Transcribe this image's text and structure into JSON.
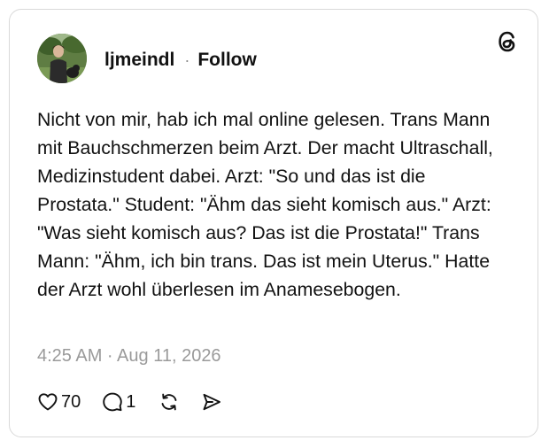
{
  "post": {
    "username": "ljmeindl",
    "separator": "·",
    "follow_label": "Follow",
    "text": "Nicht von mir, hab ich mal online gelesen. Trans Mann mit Bauchschmerzen beim Arzt. Der macht Ultraschall, Medizinstudent dabei. Arzt: \"So und das ist die Prostata.\" Student: \"Ähm das sieht komisch aus.\" Arzt: \"Was sieht komisch aus? Das ist die Prostata!\" Trans Mann: \"Ähm, ich bin trans. Das ist mein Uterus.\" Hatte der Arzt wohl überlesen im Anamesebogen.",
    "timestamp": "4:25 AM · Aug 11, 2026"
  },
  "actions": {
    "like_count": "70",
    "reply_count": "1"
  },
  "icons": {
    "logo": "threads-logo-icon",
    "like": "heart-icon",
    "reply": "comment-icon",
    "repost": "repost-icon",
    "share": "send-icon"
  },
  "colors": {
    "text": "#111111",
    "muted": "#9a9a9a",
    "border": "#d9d9d9",
    "background": "#ffffff"
  }
}
